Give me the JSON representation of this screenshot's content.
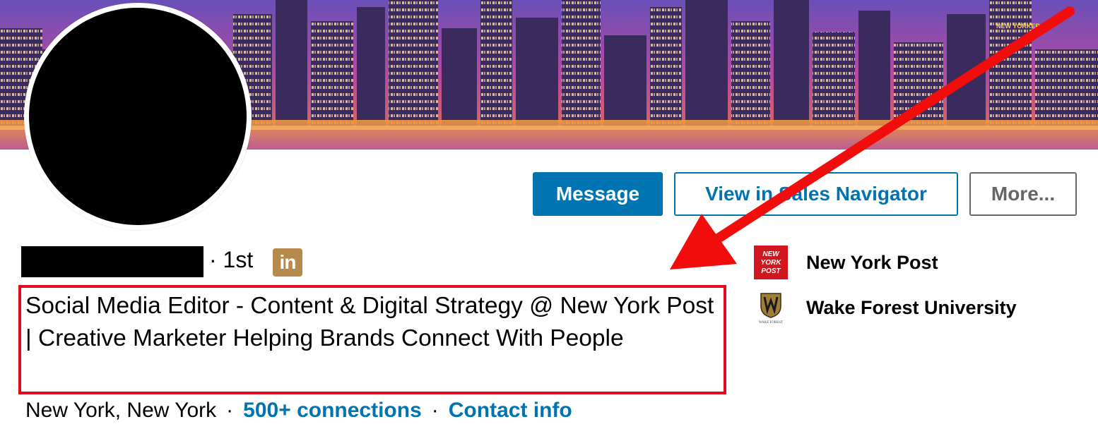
{
  "banner": {
    "icon": "city-skyline-image",
    "sign_text": "NEW YORKER"
  },
  "profile": {
    "avatar_icon": "profile-photo",
    "degree": "· 1st",
    "badge_text": "in",
    "headline": "Social Media Editor - Content & Digital Strategy @ New York Post | Creative Marketer Helping Brands Connect With People",
    "location": "New York, New York",
    "connections": "500+ connections",
    "contact": "Contact info",
    "separator": "·"
  },
  "actions": {
    "message": "Message",
    "sales_navigator": "View in Sales Navigator",
    "more": "More..."
  },
  "organizations": [
    {
      "name": "New York Post",
      "logo_text": "NEW YORK POST",
      "icon": "new-york-post-logo"
    },
    {
      "name": "Wake Forest University",
      "logo_text": "WAKE FOREST",
      "icon": "wake-forest-logo"
    }
  ],
  "colors": {
    "accent": "#0073b1",
    "highlight": "#e3091f",
    "badge": "#b58a4a",
    "nyp_red": "#d3161d"
  }
}
